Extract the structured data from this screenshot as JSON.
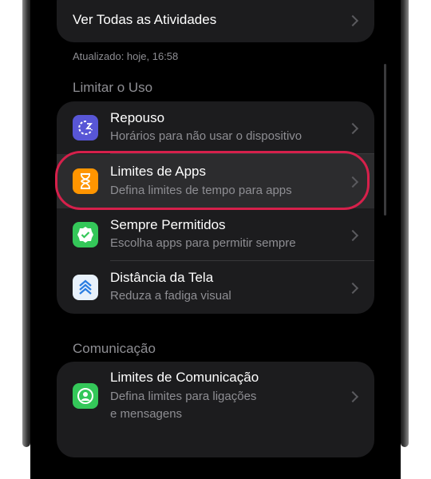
{
  "activities": {
    "see_all_label": "Ver Todas as Atividades"
  },
  "updated_text": "Atualizado: hoje, 16:58",
  "limit_usage": {
    "section_title": "Limitar o Uso",
    "items": [
      {
        "title": "Repouso",
        "subtitle": "Horários para não usar o dispositivo",
        "icon": "downtime-icon"
      },
      {
        "title": "Limites de Apps",
        "subtitle": "Defina limites de tempo para apps",
        "icon": "hourglass-icon"
      },
      {
        "title": "Sempre Permitidos",
        "subtitle": "Escolha apps para permitir sempre",
        "icon": "checkmark-badge-icon"
      },
      {
        "title": "Distância da Tela",
        "subtitle": "Reduza a fadiga visual",
        "icon": "chevrons-up-icon"
      }
    ]
  },
  "communication": {
    "section_title": "Comunicação",
    "items": [
      {
        "title": "Limites de Comunicação",
        "subtitle_line1": "Defina limites para ligações",
        "subtitle_line2": "e mensagens",
        "icon": "contact-icon"
      }
    ]
  },
  "colors": {
    "background": "#000000",
    "card": "#1c1c1e",
    "highlight": "#d6204b",
    "downtime": "#5856d6",
    "app_limits": "#ff9500",
    "always_allowed": "#34c759",
    "screen_distance": "#e8f1fb",
    "communication": "#34c759"
  }
}
